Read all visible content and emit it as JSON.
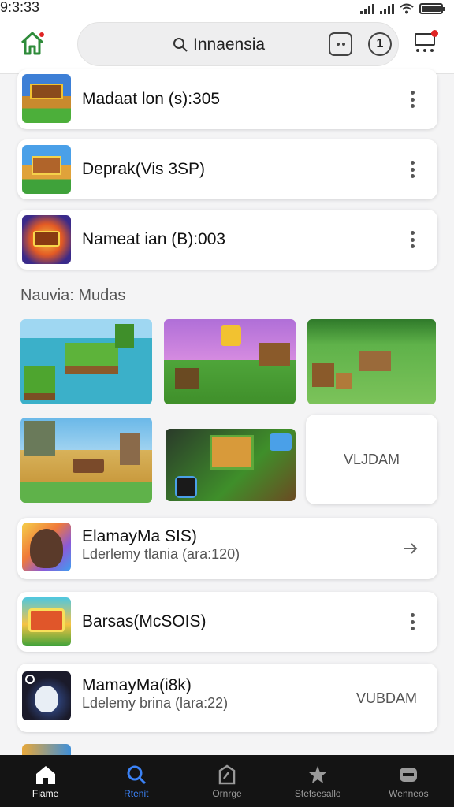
{
  "status_bar": {
    "time": "9:3:33"
  },
  "app_bar": {
    "search_text": "Innaensia",
    "notification_count": "1",
    "colors": {
      "home_icon": "#2e8b3a",
      "badge": "#e02424"
    }
  },
  "top_list": [
    {
      "title": "Madaat lon (s):305",
      "thumb_icon": "game-thumbnail-icon"
    },
    {
      "title": "Deprak(Vis 3SP)",
      "thumb_icon": "game-thumbnail-icon"
    },
    {
      "title": "Nameat ian (B):003",
      "thumb_icon": "game-thumbnail-icon"
    }
  ],
  "section": {
    "title": "Nauvia: Mudas",
    "text_tile": "VLJDAM"
  },
  "bottom_list": [
    {
      "title": "ElamayMa SIS)",
      "subtitle": "Lderlemy tlania (ara:120)",
      "action_icon": "arrow-right-icon"
    },
    {
      "title": "Barsas(McSOIS)",
      "action_icon": "kebab-menu-icon"
    },
    {
      "title": "MamayMa(i8k)",
      "subtitle": "Ldelemy brina (lara:22)",
      "side_text": "VUBDAM"
    }
  ],
  "bottom_nav": [
    {
      "label": "Fiame",
      "icon": "home-icon"
    },
    {
      "label": "Rtenit",
      "icon": "search-icon",
      "active": true
    },
    {
      "label": "Ornrge",
      "icon": "dashboard-icon"
    },
    {
      "label": "Stefsesallo",
      "icon": "star-icon"
    },
    {
      "label": "Wenneos",
      "icon": "controller-icon"
    }
  ]
}
